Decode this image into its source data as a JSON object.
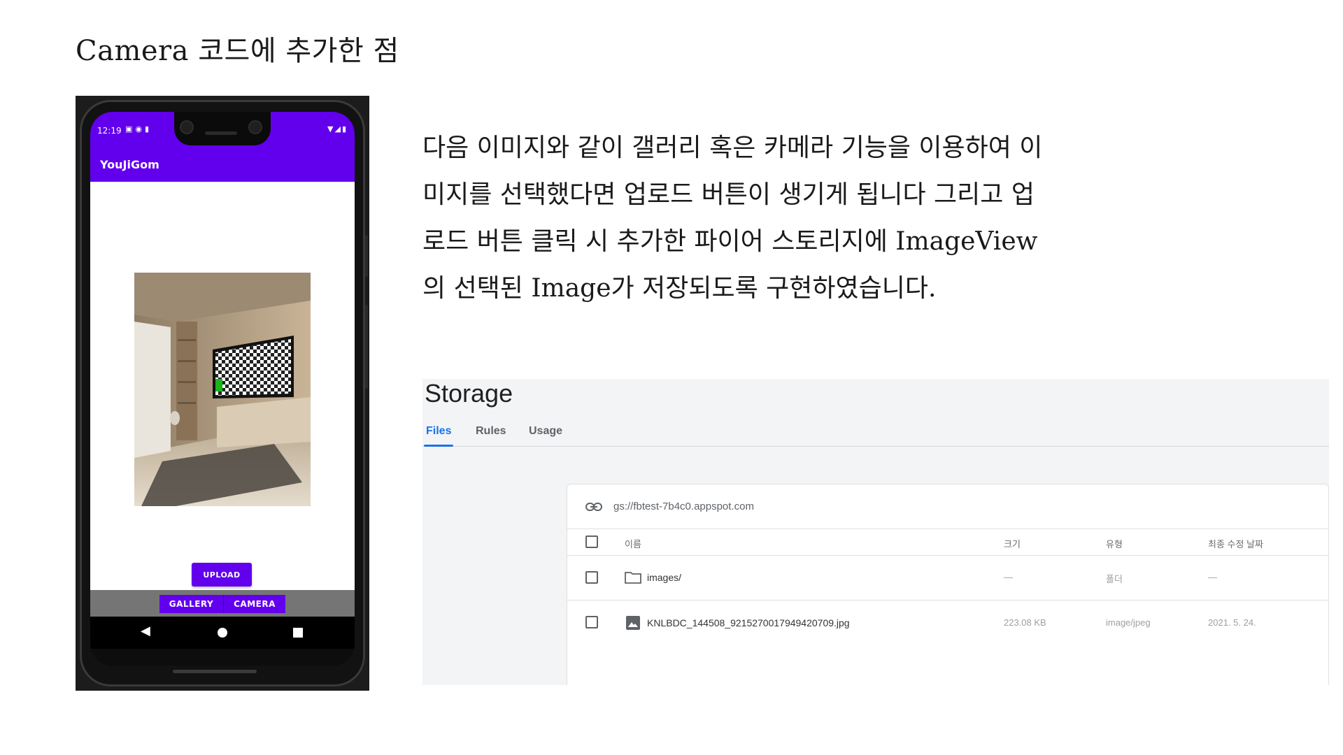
{
  "slide": {
    "title": "Camera 코드에 추가한 점",
    "description_lines": [
      "다음 이미지와 같이 갤러리 혹은 카메라 기능을 이용하여 이",
      "미지를 선택했다면 업로드 버튼이 생기게 됩니다 그리고 업",
      "로드 버튼 클릭 시 추가한 파이어 스토리지에 ImageView",
      "의 선택된 Image가 저장되도록 구현하였습니다."
    ]
  },
  "phone": {
    "status_time": "12:19",
    "status_icons_left": [
      "sim-icon",
      "chrome-icon",
      "sd-card-icon"
    ],
    "status_icons_right": [
      "wifi-icon",
      "signal-icon",
      "battery-icon"
    ],
    "app_title": "YouJiGom",
    "upload_label": "UPLOAD",
    "gallery_label": "GALLERY",
    "camera_label": "CAMERA",
    "accent_color": "#6200ee"
  },
  "storage": {
    "title": "Storage",
    "tabs": [
      {
        "label": "Files",
        "active": true
      },
      {
        "label": "Rules",
        "active": false
      },
      {
        "label": "Usage",
        "active": false
      }
    ],
    "bucket_url": "gs://fbtest-7b4c0.appspot.com",
    "columns": [
      "이름",
      "크기",
      "유형",
      "최종 수정 날짜"
    ],
    "rows": [
      {
        "name": "images/",
        "size": "—",
        "type": "폴더",
        "modified": "—",
        "icon": "folder-icon"
      },
      {
        "name": "KNLBDC_144508_9215270017949420709.jpg",
        "size": "223.08 KB",
        "type": "image/jpeg",
        "modified": "2021. 5. 24.",
        "icon": "image-icon"
      }
    ],
    "accent_color": "#1a73e8"
  }
}
